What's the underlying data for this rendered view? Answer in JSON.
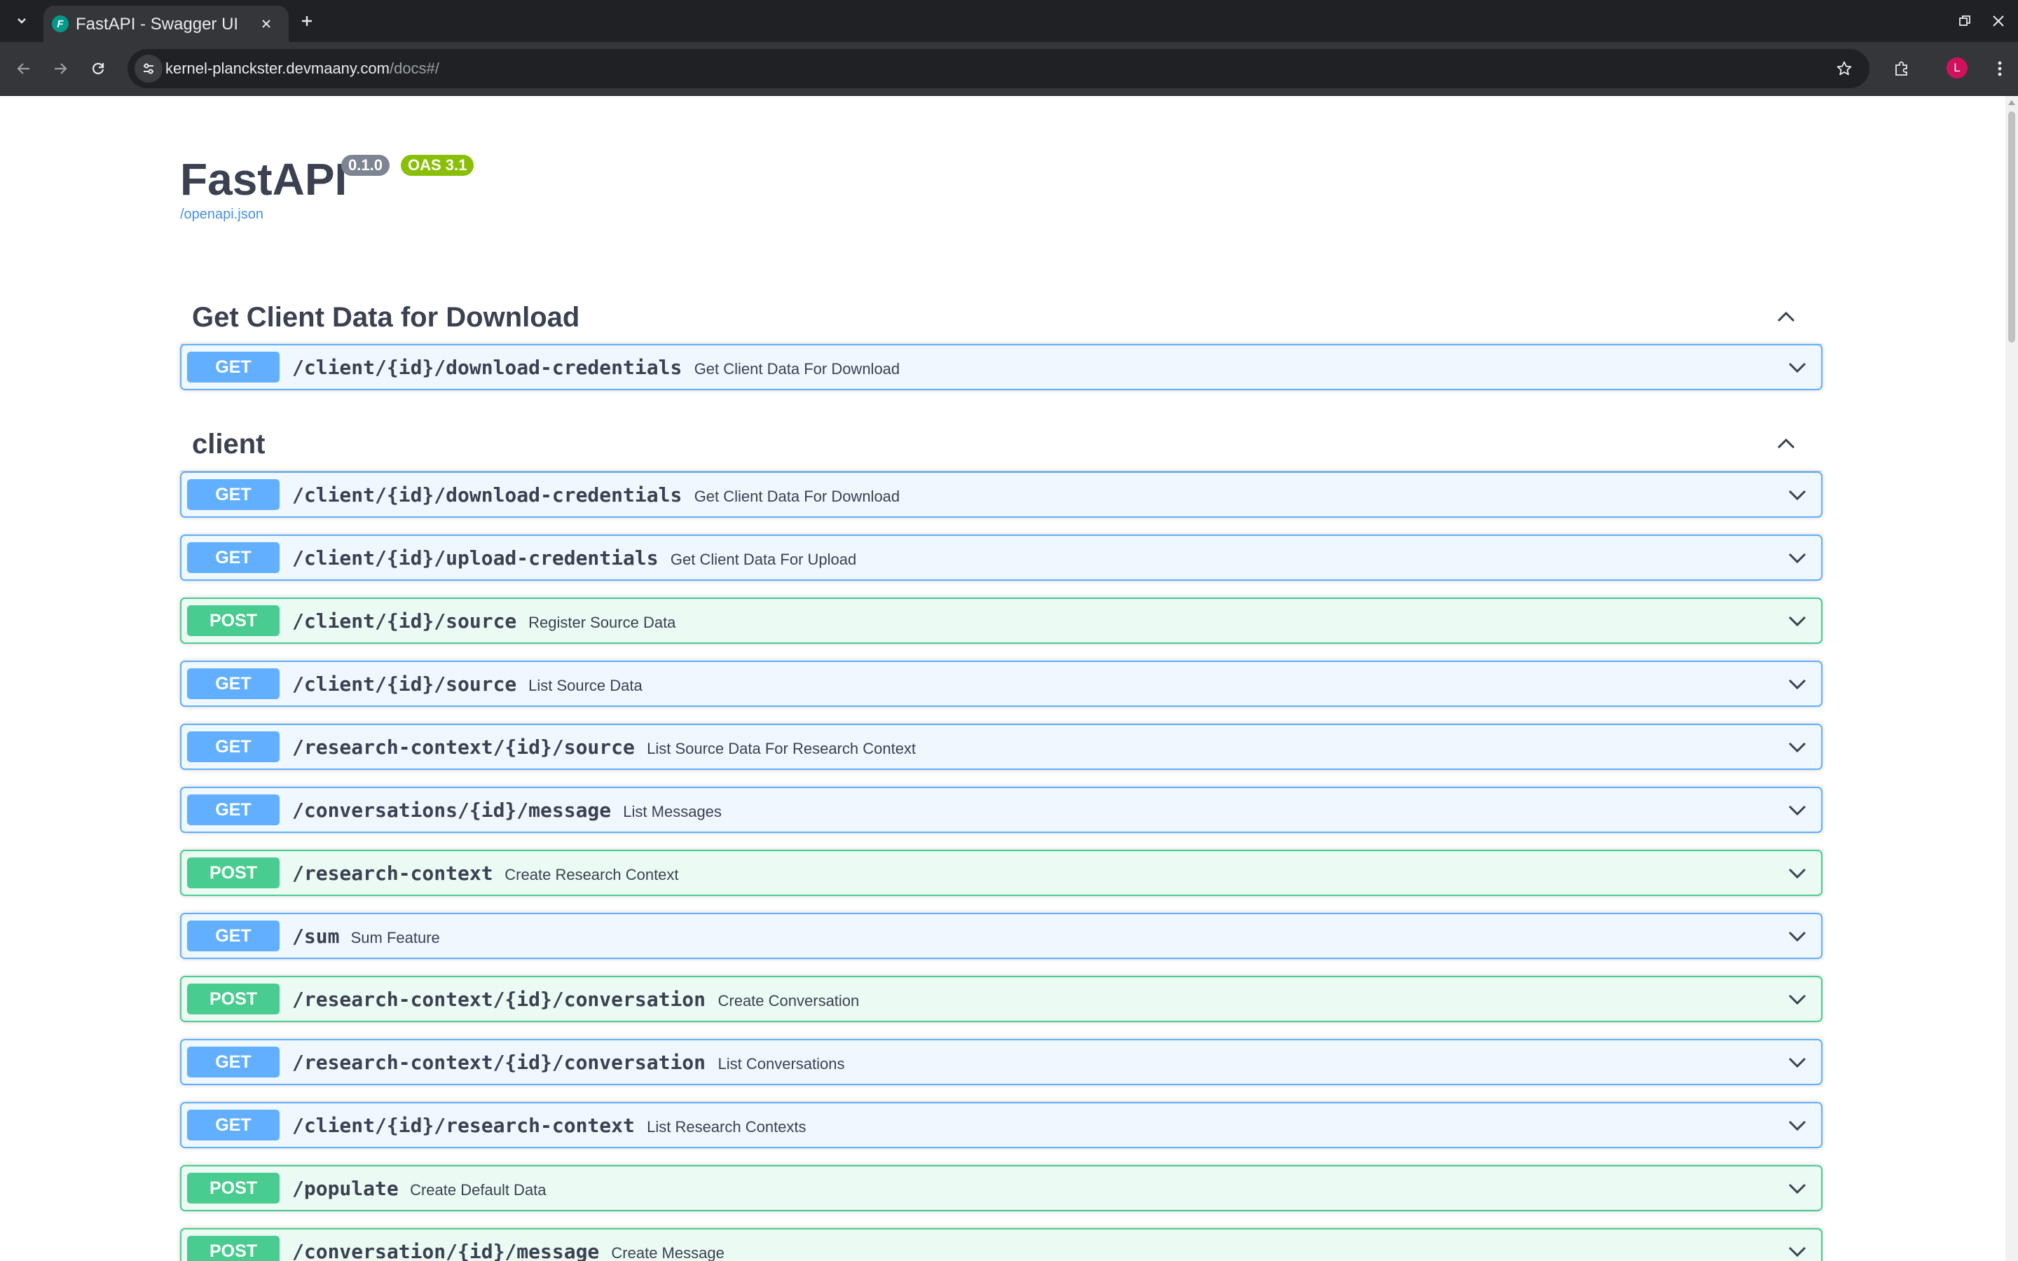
{
  "browser": {
    "tab_title": "FastAPI - Swagger UI",
    "favicon_letter": "F",
    "url_host": "kernel-planckster.devmaany.com",
    "url_path": "/docs#/",
    "profile_initial": "L"
  },
  "info": {
    "title": "FastAPI",
    "version": "0.1.0",
    "oas": "OAS 3.1",
    "spec_link": "/openapi.json"
  },
  "tags": [
    {
      "name": "Get Client Data for Download",
      "operations": [
        {
          "method": "GET",
          "path": "/client/{id}/download-credentials",
          "summary": "Get Client Data For Download"
        }
      ]
    },
    {
      "name": "client",
      "operations": [
        {
          "method": "GET",
          "path": "/client/{id}/download-credentials",
          "summary": "Get Client Data For Download"
        },
        {
          "method": "GET",
          "path": "/client/{id}/upload-credentials",
          "summary": "Get Client Data For Upload"
        },
        {
          "method": "POST",
          "path": "/client/{id}/source",
          "summary": "Register Source Data"
        },
        {
          "method": "GET",
          "path": "/client/{id}/source",
          "summary": "List Source Data"
        },
        {
          "method": "GET",
          "path": "/research-context/{id}/source",
          "summary": "List Source Data For Research Context"
        },
        {
          "method": "GET",
          "path": "/conversations/{id}/message",
          "summary": "List Messages"
        },
        {
          "method": "POST",
          "path": "/research-context",
          "summary": "Create Research Context"
        },
        {
          "method": "GET",
          "path": "/sum",
          "summary": "Sum Feature"
        },
        {
          "method": "POST",
          "path": "/research-context/{id}/conversation",
          "summary": "Create Conversation"
        },
        {
          "method": "GET",
          "path": "/research-context/{id}/conversation",
          "summary": "List Conversations"
        },
        {
          "method": "GET",
          "path": "/client/{id}/research-context",
          "summary": "List Research Contexts"
        },
        {
          "method": "POST",
          "path": "/populate",
          "summary": "Create Default Data"
        },
        {
          "method": "POST",
          "path": "/conversation/{id}/message",
          "summary": "Create Message"
        }
      ]
    }
  ]
}
